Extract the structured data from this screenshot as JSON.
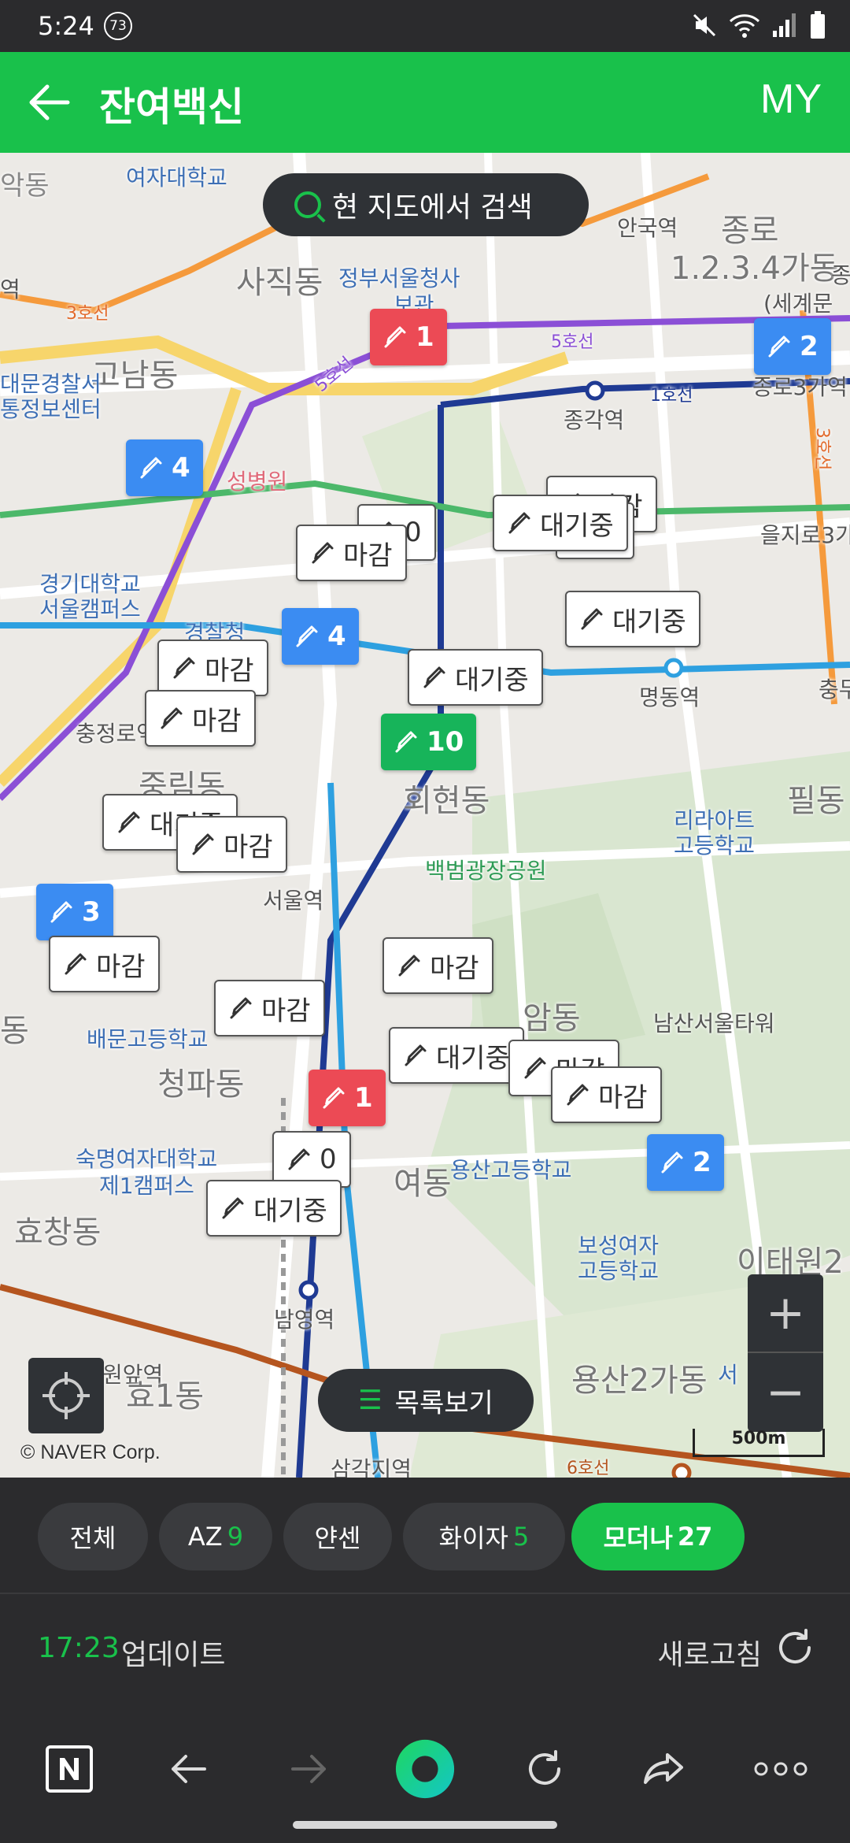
{
  "status_bar": {
    "time": "5:24",
    "temperature_badge": "73"
  },
  "header": {
    "title": "잔여백신",
    "right_label": "MY"
  },
  "map": {
    "search_label": "현 지도에서 검색",
    "list_view_label": "목록보기",
    "copyright": "© NAVER Corp.",
    "scale_label": "500m",
    "zoom_in": "+",
    "zoom_out": "−",
    "places": [
      "여자대학교",
      "악동",
      "사직동",
      "정부서울청사",
      "보관",
      "안국역",
      "종로",
      "1.2.3.4가동",
      "종",
      "(세계문",
      "역",
      "3호선",
      "고남동",
      "5호선",
      "대문경찰서",
      "통정보센터",
      "5호선",
      "종각역",
      "1호선",
      "종로3가역",
      "성병원",
      "3호선",
      "을지로3가",
      "경기대학교",
      "서울캠퍼스",
      "경찰청",
      "명동역",
      "충무",
      "충정로역",
      "중림동",
      "회현동",
      "리라아트",
      "고등학교",
      "필동",
      "백범광장공원",
      "서울역",
      "배문고등학교",
      "청파동",
      "남산서울타워",
      "숙명여자대학교",
      "제1캠퍼스",
      "용산고등학교",
      "효창동",
      "보성여자",
      "고등학교",
      "이태원2",
      "남영역",
      "원앞역",
      "효1동",
      "용산2가동",
      "서",
      "삼각지역",
      "6호선",
      "암동",
      "여동",
      "동"
    ],
    "markers": [
      {
        "label": "1",
        "style": "red"
      },
      {
        "label": "2",
        "style": "blue"
      },
      {
        "label": "4",
        "style": "blue"
      },
      {
        "label": "마감",
        "style": "white"
      },
      {
        "label": "0",
        "style": "white"
      },
      {
        "label": "0",
        "style": "white"
      },
      {
        "label": "대기중",
        "style": "white"
      },
      {
        "label": "마감",
        "style": "white"
      },
      {
        "label": "4",
        "style": "blue"
      },
      {
        "label": "마감",
        "style": "white"
      },
      {
        "label": "대기중",
        "style": "white"
      },
      {
        "label": "마감",
        "style": "white"
      },
      {
        "label": "대기중",
        "style": "white"
      },
      {
        "label": "10",
        "style": "green"
      },
      {
        "label": "대기중",
        "style": "white"
      },
      {
        "label": "마감",
        "style": "white"
      },
      {
        "label": "3",
        "style": "blue"
      },
      {
        "label": "마감",
        "style": "white"
      },
      {
        "label": "마감",
        "style": "white"
      },
      {
        "label": "마감",
        "style": "white"
      },
      {
        "label": "대기중",
        "style": "white"
      },
      {
        "label": "마감",
        "style": "white"
      },
      {
        "label": "마감",
        "style": "white"
      },
      {
        "label": "1",
        "style": "red"
      },
      {
        "label": "0",
        "style": "white"
      },
      {
        "label": "2",
        "style": "blue"
      },
      {
        "label": "대기중",
        "style": "white"
      }
    ]
  },
  "filters": [
    {
      "label": "전체",
      "count": ""
    },
    {
      "label": "AZ",
      "count": "9"
    },
    {
      "label": "얀센",
      "count": ""
    },
    {
      "label": "화이자",
      "count": "5"
    },
    {
      "label": "모더나",
      "count": "27",
      "active": true
    }
  ],
  "update": {
    "time": "17:23",
    "label": "업데이트",
    "refresh_label": "새로고침"
  },
  "colors": {
    "brand_green": "#19c14b",
    "dark_bg": "#2b2b2d",
    "marker_blue": "#3b8cf2",
    "marker_red": "#ec4a55"
  },
  "bottom_nav": [
    "naver-icon",
    "back-icon",
    "forward-icon",
    "green-dot-icon",
    "reload-icon",
    "share-icon",
    "more-icon"
  ]
}
